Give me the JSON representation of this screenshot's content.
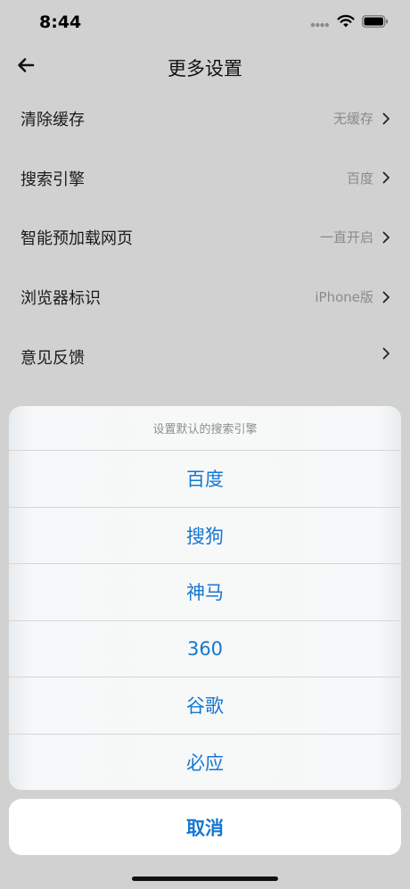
{
  "status_bar": {
    "time": "8:44",
    "icons": [
      "signal-dots-icon",
      "wifi-icon",
      "battery-icon"
    ]
  },
  "nav": {
    "title": "更多设置",
    "back_icon": "arrow-left-icon"
  },
  "settings": [
    {
      "label": "清除缓存",
      "value": "无缓存"
    },
    {
      "label": "搜索引擎",
      "value": "百度"
    },
    {
      "label": "智能预加载网页",
      "value": "一直开启"
    },
    {
      "label": "浏览器标识",
      "value": "iPhone版"
    },
    {
      "label": "意见反馈",
      "value": ""
    }
  ],
  "action_sheet": {
    "title": "设置默认的搜索引擎",
    "options": [
      "百度",
      "搜狗",
      "神马",
      "360",
      "谷歌",
      "必应"
    ],
    "cancel_label": "取消"
  },
  "colors": {
    "accent": "#1677d2",
    "backdrop": "#d1d1d1",
    "secondary_text": "#8a8a8a"
  }
}
